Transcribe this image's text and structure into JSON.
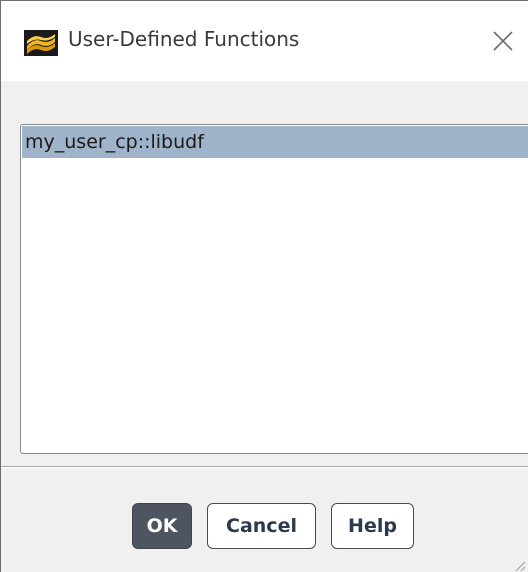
{
  "window": {
    "title": "User-Defined Functions",
    "icons": {
      "app": "fluent-app-icon",
      "close": "close-icon",
      "resize": "resize-grip-icon"
    }
  },
  "list": {
    "items": [
      {
        "label": "my_user_cp::libudf",
        "selected": true
      }
    ],
    "selection_color": "#9fb3ca"
  },
  "buttons": {
    "ok": "OK",
    "cancel": "Cancel",
    "help": "Help"
  },
  "colors": {
    "primary_button": "#4e5561",
    "panel_background": "#f0f0f0"
  }
}
